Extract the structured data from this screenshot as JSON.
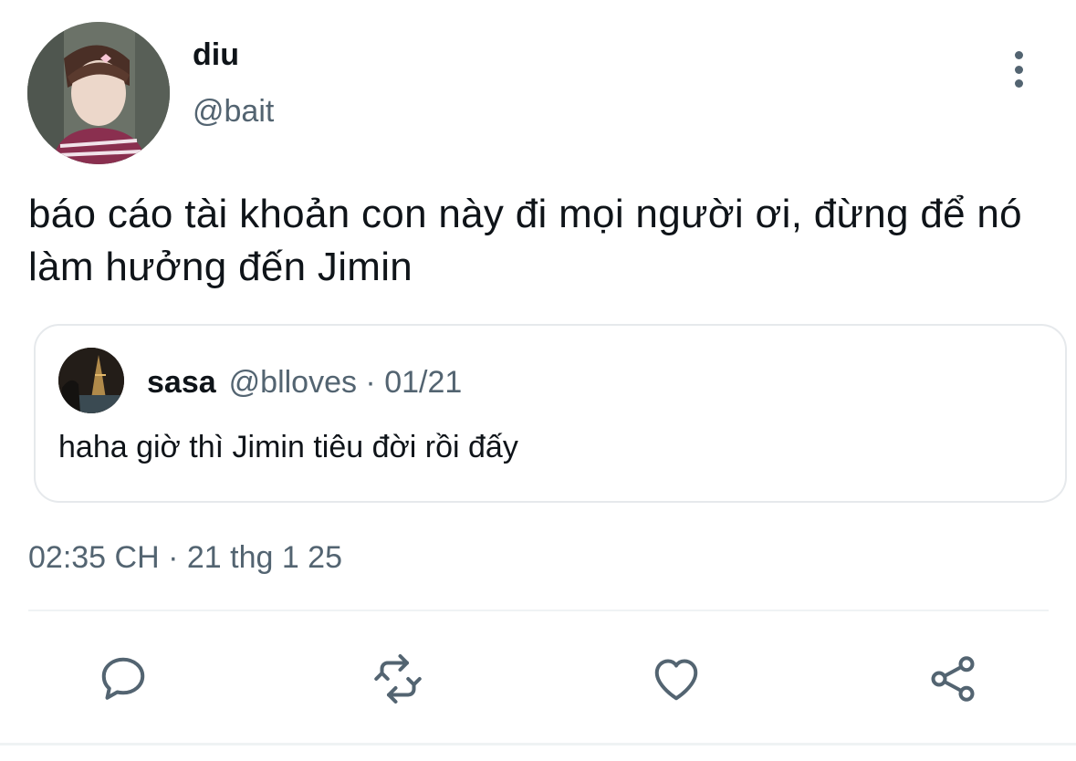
{
  "tweet": {
    "author": {
      "display_name": "diu",
      "handle": "@bait"
    },
    "text": "báo cáo tài khoản con này đi mọi người ơi, đừng để nó làm hưởng đến Jimin",
    "quoted": {
      "display_name": "sasa",
      "meta": "@blloves · 01/21",
      "text": "haha giờ thì Jimin tiêu đời rồi đấy"
    },
    "timestamp": "02:35 CH · 21 thg 1 25"
  },
  "actions": {
    "reply_icon": "comment-icon",
    "retweet_icon": "retweet-icon",
    "like_icon": "heart-icon",
    "share_icon": "share-icon"
  },
  "colors": {
    "text": "#0f1419",
    "secondary": "#536471",
    "border": "#e6e9ec"
  }
}
